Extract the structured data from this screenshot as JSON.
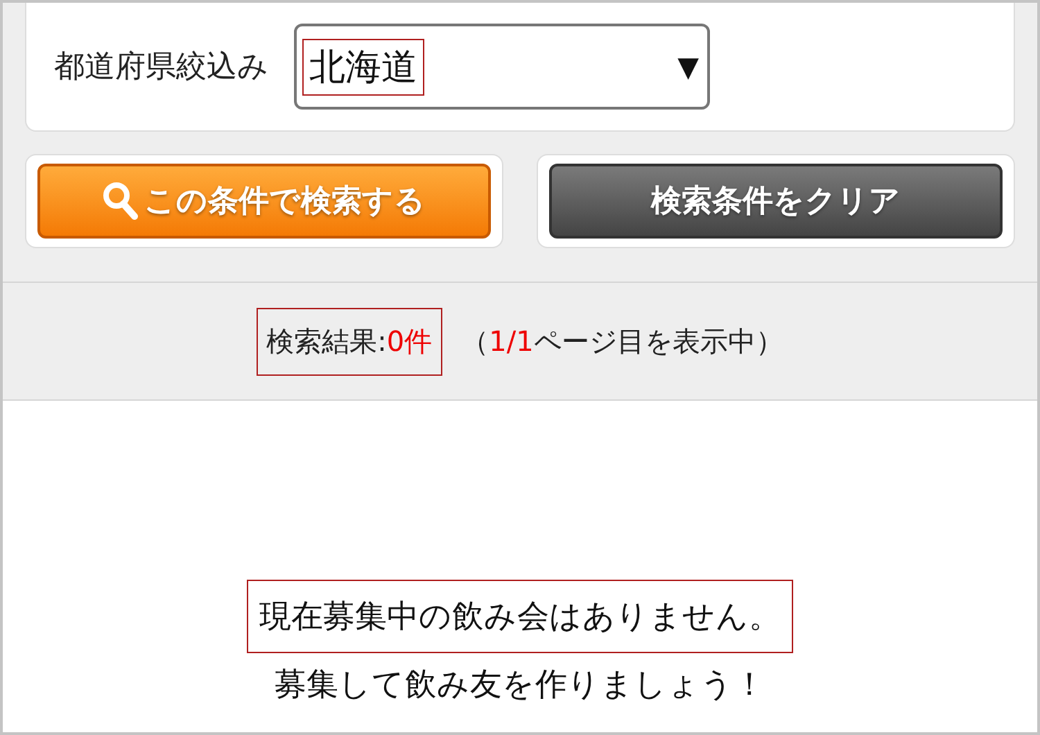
{
  "filter": {
    "label": "都道府県絞込み",
    "value": "北海道",
    "value_highlighted": true,
    "arrow": "▼"
  },
  "buttons": [
    {
      "kind": "search",
      "label": "この条件で検索する"
    },
    {
      "kind": "clear",
      "label": "検索条件をクリア"
    }
  ],
  "result": {
    "count_parts": [
      {
        "text": "検索結果:",
        "red": false
      },
      {
        "text": "0件",
        "red": true
      }
    ],
    "count_highlighted": true,
    "page_parts": [
      {
        "text": "（",
        "red": false
      },
      {
        "text": "1/1",
        "red": true
      },
      {
        "text": "ページ目を表示中）",
        "red": false
      }
    ]
  },
  "message": {
    "lines": [
      {
        "text": "現在募集中の飲み会はありません。",
        "highlighted": true
      },
      {
        "text": "募集して飲み友を作りましょう！",
        "highlighted": false
      }
    ]
  }
}
